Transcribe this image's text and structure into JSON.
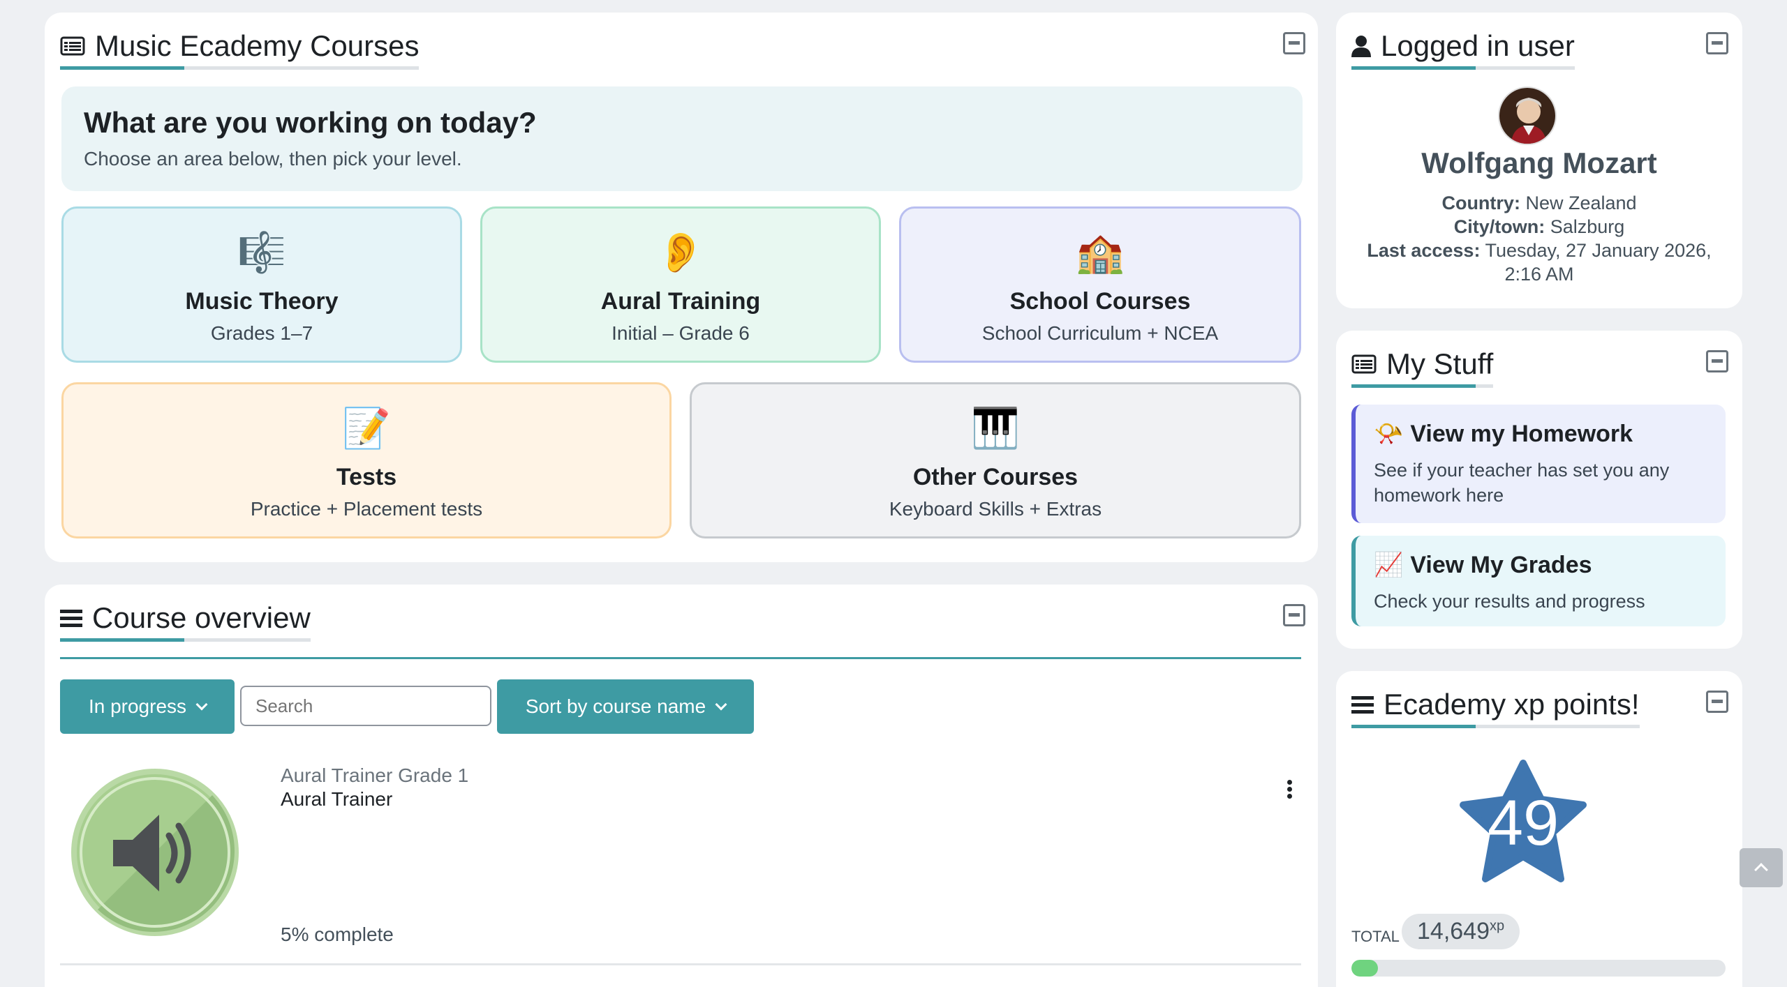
{
  "courses": {
    "title": "Music Ecademy Courses",
    "hero_title": "What are you working on today?",
    "hero_subtitle": "Choose an area below, then pick your level.",
    "tiles": [
      {
        "emoji": "🎼",
        "title": "Music Theory",
        "subtitle": "Grades 1–7"
      },
      {
        "emoji": "👂",
        "title": "Aural Training",
        "subtitle": "Initial – Grade 6"
      },
      {
        "emoji": "🏫",
        "title": "School Courses",
        "subtitle": "School Curriculum + NCEA"
      },
      {
        "emoji": "📝",
        "title": "Tests",
        "subtitle": "Practice + Placement tests"
      },
      {
        "emoji": "🎹",
        "title": "Other Courses",
        "subtitle": "Keyboard Skills + Extras"
      }
    ]
  },
  "overview": {
    "title": "Course overview",
    "filter_label": "In progress",
    "search_placeholder": "Search",
    "sort_label": "Sort by course name",
    "course": {
      "category": "Aural Trainer Grade 1",
      "name": "Aural Trainer",
      "progress_text": "5% complete",
      "progress_percent": 5
    }
  },
  "user": {
    "title": "Logged in user",
    "name": "Wolfgang Mozart",
    "country_label": "Country:",
    "country": "New Zealand",
    "city_label": "City/town:",
    "city": "Salzburg",
    "access_label": "Last access:",
    "access": "Tuesday, 27 January 2026,",
    "access_time": "2:16 AM"
  },
  "stuff": {
    "title": "My Stuff",
    "homework_title": "View my Homework",
    "homework_desc": "See if your teacher has set you any homework here",
    "grades_title": "View My Grades",
    "grades_desc": "Check your results and progress"
  },
  "xp": {
    "title": "Ecademy xp points!",
    "level": "49",
    "total_label": "TOTAL",
    "total": "14,649",
    "unit": "xp",
    "progress_fraction": 0.07
  },
  "colors": {
    "accent": "#3e9ba3",
    "theory": "#e6f4f8",
    "aural": "#e8f8f1",
    "school": "#eef0fb",
    "tests": "#fff4e6",
    "other": "#f1f2f4"
  }
}
